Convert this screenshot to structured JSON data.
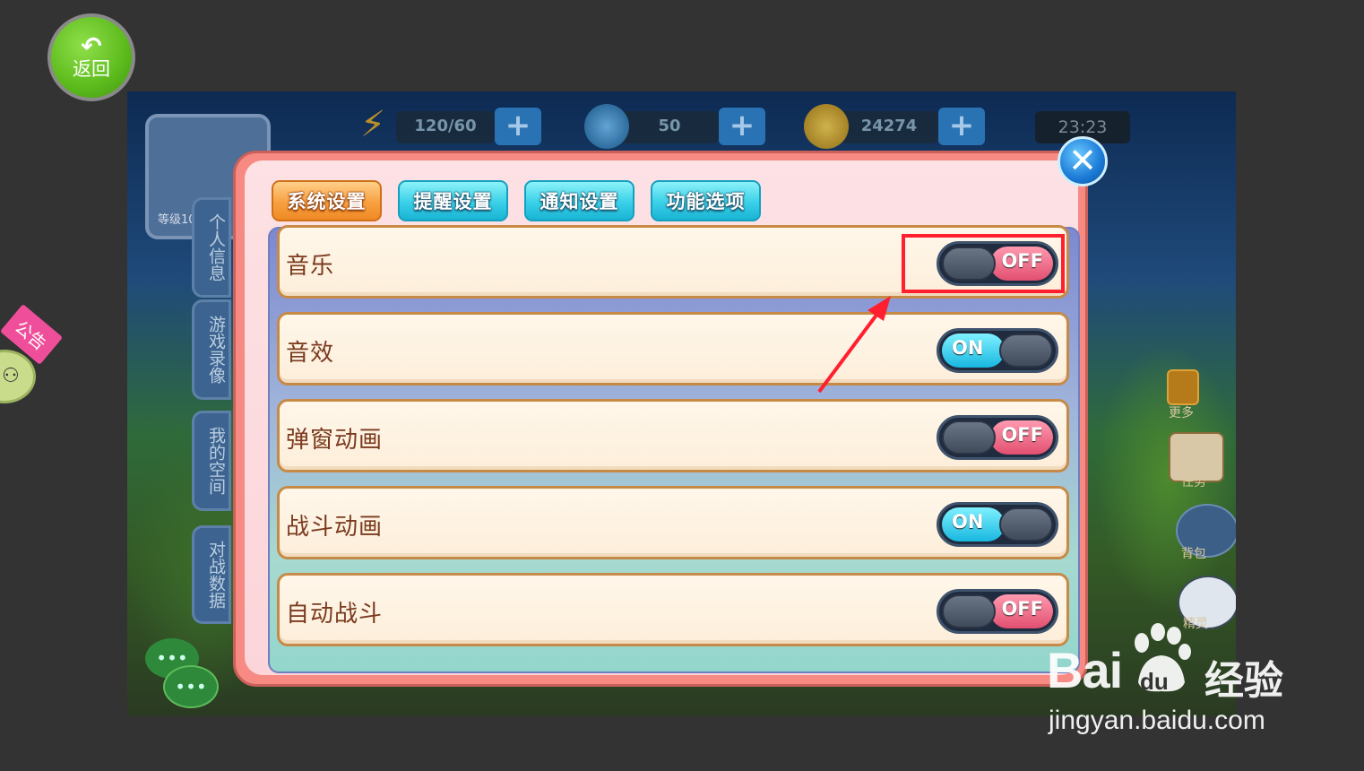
{
  "back_button": {
    "label": "返回",
    "icon": "back-arrow-icon"
  },
  "notice_badge": {
    "label": "公告"
  },
  "top_bar": {
    "energy": "120/60",
    "gems": "50",
    "gold": "24274",
    "time": "23:23"
  },
  "profile": {
    "level_label": "等级10"
  },
  "side_tabs": [
    "个人信息",
    "游戏录像",
    "我的空间",
    "对战数据"
  ],
  "settings": {
    "tabs": [
      {
        "label": "系统设置",
        "active": true
      },
      {
        "label": "提醒设置",
        "active": false
      },
      {
        "label": "通知设置",
        "active": false
      },
      {
        "label": "功能选项",
        "active": false
      }
    ],
    "rows": [
      {
        "label": "音乐",
        "toggle": "OFF"
      },
      {
        "label": "音效",
        "toggle": "ON"
      },
      {
        "label": "弹窗动画",
        "toggle": "OFF"
      },
      {
        "label": "战斗动画",
        "toggle": "ON"
      },
      {
        "label": "自动战斗",
        "toggle": "OFF"
      }
    ],
    "close_icon": "close-x-icon"
  },
  "right_icons": {
    "more": "更多",
    "task": "任务",
    "bag": "背包",
    "spirit": "精灵"
  },
  "watermark": {
    "brand": "Bai",
    "brand_du": "du",
    "brand_cn": "经验",
    "url": "jingyan.baidu.com"
  },
  "colors": {
    "off": "#e24f70",
    "on": "#18b8e0",
    "annotation": "#ff1f2f",
    "tab_active": "#ef8a24",
    "tab_idle": "#1ab4d4"
  }
}
